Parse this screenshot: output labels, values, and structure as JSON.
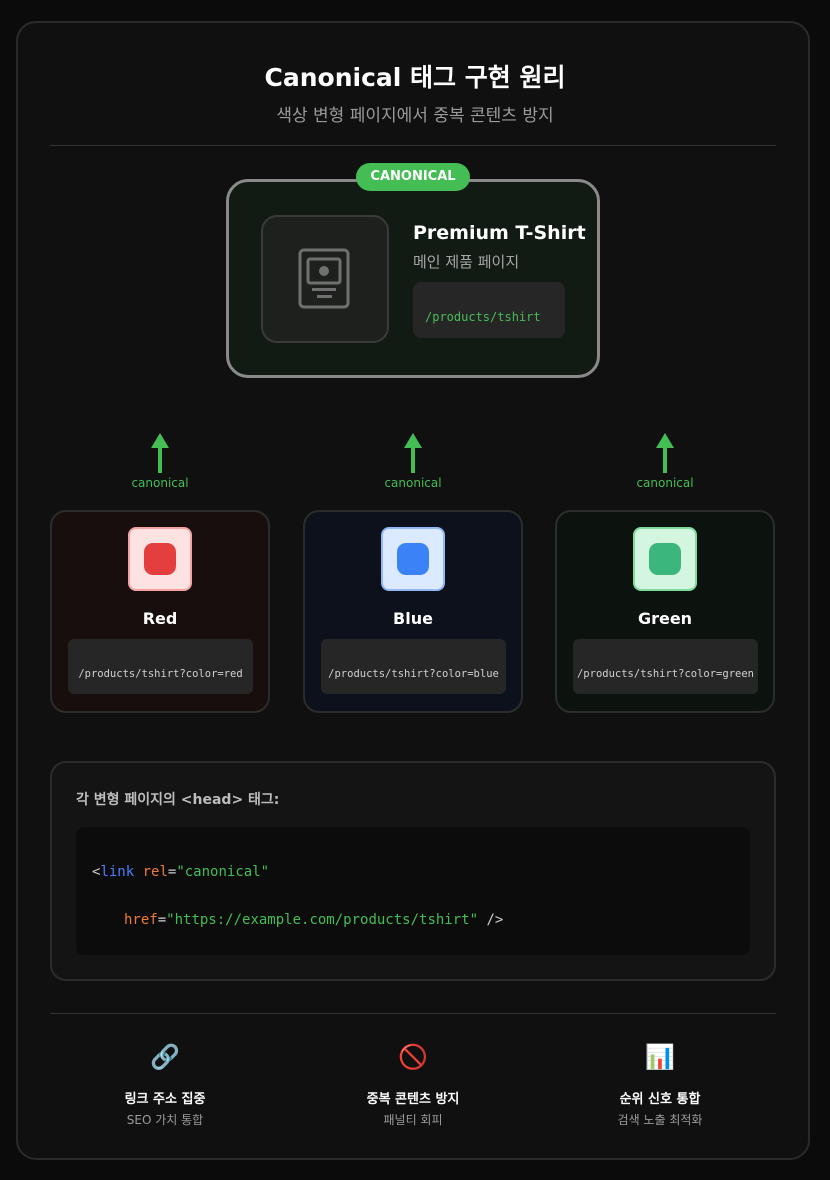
{
  "header": {
    "title": "Canonical 태그 구현 원리",
    "subtitle": "색상 변형 페이지에서 중복 콘텐츠 방지"
  },
  "canonical_card": {
    "badge": "CANONICAL",
    "product_name": "Premium T-Shirt",
    "description": "메인 제품 페이지",
    "url": "/products/tshirt"
  },
  "arrows": [
    {
      "label": "canonical"
    },
    {
      "label": "canonical"
    },
    {
      "label": "canonical"
    }
  ],
  "variants": [
    {
      "name": "Red",
      "url": "/products/tshirt?color=red",
      "color": "#e53e3e",
      "box_bg": "#fde2e2",
      "box_border": "#f4a3a3",
      "card_bg": "#170e0d"
    },
    {
      "name": "Blue",
      "url": "/products/tshirt?color=blue",
      "color": "#3b82f6",
      "box_bg": "#dbeafe",
      "box_border": "#93b8f5",
      "card_bg": "#0c111c"
    },
    {
      "name": "Green",
      "url": "/products/tshirt?color=green",
      "color": "#3bb77e",
      "box_bg": "#d4f5df",
      "box_border": "#7fdb9c",
      "card_bg": "#0c130f"
    }
  ],
  "code_section": {
    "title": "각 변형 페이지의 <head> 태그:",
    "line1": {
      "open": "<",
      "tag": "link",
      "attr": "rel",
      "eq": "=",
      "value": "\"canonical\""
    },
    "line2": {
      "attr": "href",
      "eq": "=",
      "value": "\"https://example.com/products/tshirt\"",
      "close": " />"
    }
  },
  "benefits": [
    {
      "icon": "link-icon",
      "glyph": "🔗",
      "title": "링크 주소 집중",
      "desc": "SEO 가치 통합"
    },
    {
      "icon": "no-entry-icon",
      "glyph": "🚫",
      "title": "중복 콘텐츠 방지",
      "desc": "패널티 회피"
    },
    {
      "icon": "bar-chart-icon",
      "glyph": "📊",
      "title": "순위 신호 통합",
      "desc": "검색 노출 최적화"
    }
  ],
  "colors": {
    "accent_green": "#45bd55",
    "tag_blue": "#4a7dfc",
    "attr_orange": "#f07a3a"
  }
}
